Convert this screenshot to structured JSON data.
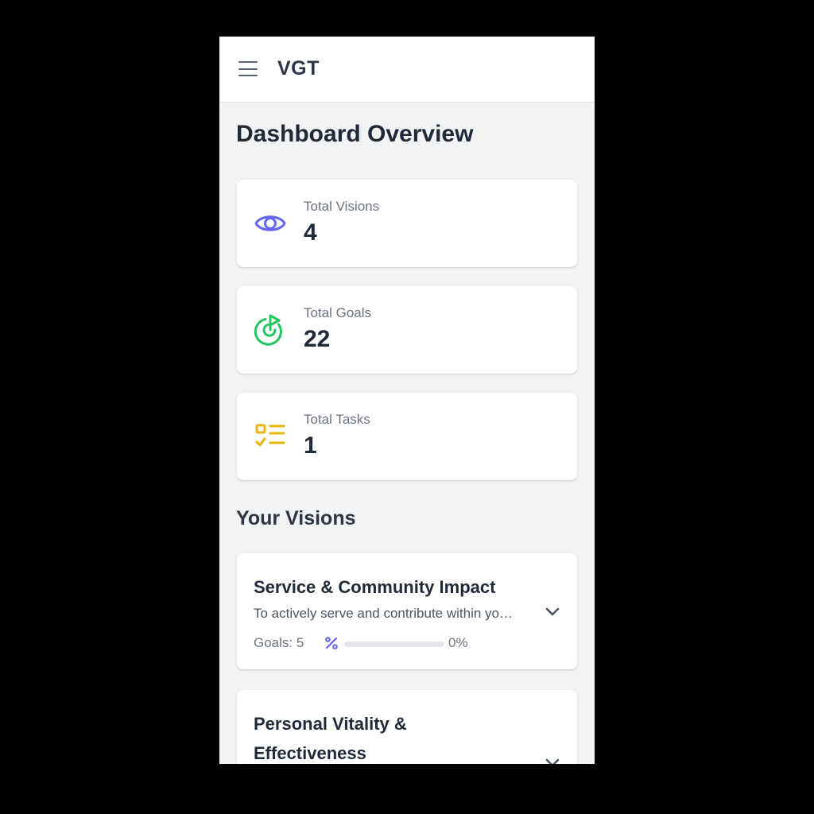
{
  "app": {
    "title": "VGT"
  },
  "page": {
    "title": "Dashboard Overview"
  },
  "stats": [
    {
      "label": "Total Visions",
      "value": "4",
      "icon": "eye-icon",
      "color": "#6366f1"
    },
    {
      "label": "Total Goals",
      "value": "22",
      "icon": "target-icon",
      "color": "#22c55e"
    },
    {
      "label": "Total Tasks",
      "value": "1",
      "icon": "checklist-icon",
      "color": "#eab308"
    }
  ],
  "visions_section": {
    "title": "Your Visions",
    "items": [
      {
        "title": "Service & Community Impact",
        "description": "To actively serve and contribute within your community and beyond.",
        "goals": "Goals: 5",
        "progress_text": "0%",
        "progress": 0
      },
      {
        "title": "Personal Vitality & Effectiveness"
      }
    ]
  },
  "colors": {
    "accent": "#6366f1",
    "goals_green": "#22c55e",
    "tasks_yellow": "#eab308",
    "background": "#f2f3f5",
    "text_dark": "#1f2937",
    "text_muted": "#6b7280"
  }
}
